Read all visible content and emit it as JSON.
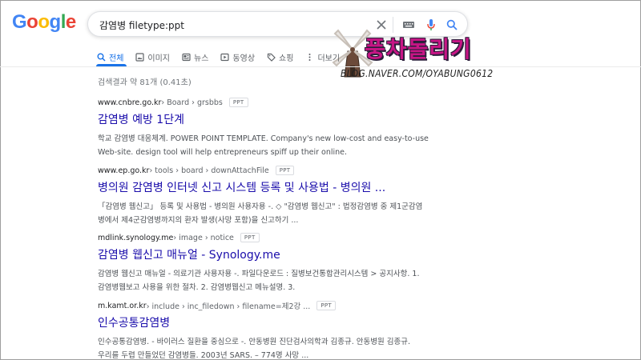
{
  "logo": {
    "letters": [
      "G",
      "o",
      "o",
      "g",
      "l",
      "e"
    ],
    "colors": [
      "#4285F4",
      "#EA4335",
      "#FBBC05",
      "#4285F4",
      "#34A853",
      "#EA4335"
    ]
  },
  "search": {
    "query": "감염병 filetype:ppt"
  },
  "tabs": [
    {
      "label": "전체",
      "icon": "search-icon",
      "active": true
    },
    {
      "label": "이미지",
      "icon": "image-icon"
    },
    {
      "label": "뉴스",
      "icon": "news-icon"
    },
    {
      "label": "동영상",
      "icon": "video-icon"
    },
    {
      "label": "쇼핑",
      "icon": "tag-icon"
    },
    {
      "label": "더보기",
      "icon": "more-vert-icon"
    }
  ],
  "watermark": {
    "title": "풍차돌리기",
    "url": "BLOG.NAVER.COM/OYABUNG0612"
  },
  "stats": "검색결과 약 81개 (0.41초)",
  "results": [
    {
      "cite_domain": "www.cnbre.go.kr",
      "cite_path": " › Board › grsbbs",
      "badge": "PPT",
      "title": "감염병 예방 1단계",
      "snippet": [
        "학교 감염병 대응체계. POWER POINT TEMPLATE. Company's new low-cost and easy-to-use",
        "Web-site. design tool will help entrepreneurs spiff up their online."
      ]
    },
    {
      "cite_domain": "www.ep.go.kr",
      "cite_path": " › tools › board › downAttachFile",
      "badge": "PPT",
      "title": "병의원 감염병 인터넷 신고 시스템 등록 및 사용법 - 병의원 ...",
      "snippet": [
        "「감염병 웹신고」 등록 및 사용법 - 병의원 사용자용 -. ◇ \"감염병 웹신고\" : 법정감염병 중 제1군감염",
        "병에서 제4군감염병까지의 환자 발생(사망 포함)을 신고하기 ..."
      ]
    },
    {
      "cite_domain": "mdlink.synology.me",
      "cite_path": " › image › notice",
      "badge": "PPT",
      "title": "감염병 웹신고 매뉴얼 - Synology.me",
      "snippet": [
        "감염병 웹신고 매뉴얼 - 의료기관 사용자용 -. 파일다운로드 : 질병보건통합관리시스템 > 공지사항. 1.",
        "감염병웹보고 사용을 위한 절차. 2. 감염병웹신고 메뉴설명. 3."
      ]
    },
    {
      "cite_domain": "m.kamt.or.kr",
      "cite_path": " › include › inc_filedown › filename=제2강 ...",
      "badge": "PPT",
      "title": "인수공통감염병",
      "snippet": [
        "인수공통감염병. - 바이러스 질환을 중심으로 -. 안동병원 진단검사의학과 김종규. 안동병원 김종규.",
        "우리를 두렵 만들었던 감염병들. 2003년 SARS. – 774명 사망 ..."
      ]
    }
  ]
}
